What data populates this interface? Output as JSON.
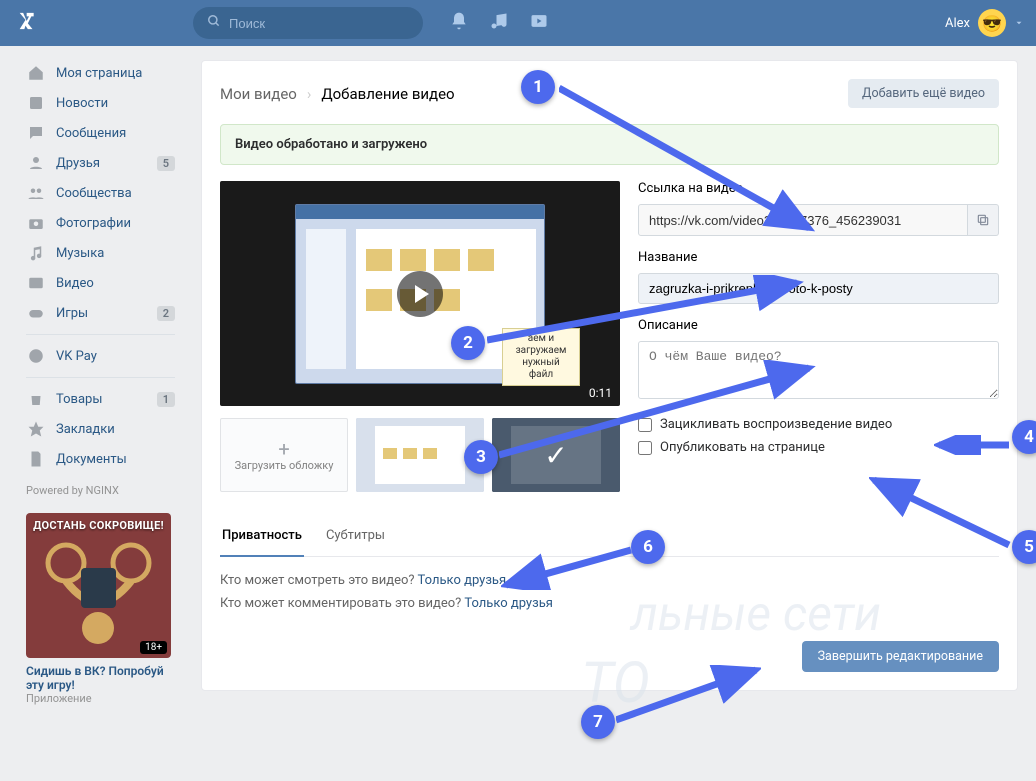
{
  "header": {
    "search_placeholder": "Поиск",
    "user_name": "Alex"
  },
  "sidebar": {
    "items": [
      {
        "label": "Моя страница"
      },
      {
        "label": "Новости"
      },
      {
        "label": "Сообщения"
      },
      {
        "label": "Друзья",
        "badge": "5"
      },
      {
        "label": "Сообщества"
      },
      {
        "label": "Фотографии"
      },
      {
        "label": "Музыка"
      },
      {
        "label": "Видео"
      },
      {
        "label": "Игры",
        "badge": "2"
      },
      {
        "label": "VK Pay"
      },
      {
        "label": "Товары",
        "badge": "1"
      },
      {
        "label": "Закладки"
      },
      {
        "label": "Документы"
      }
    ],
    "powered": "Powered by NGINX"
  },
  "promo": {
    "img_title": "ДОСТАНЬ СОКРОВИЩЕ!",
    "badge": "18+",
    "link": "Сидишь в ВК? Попробуй эту игру!",
    "sub": "Приложение"
  },
  "crumbs": {
    "root": "Мои видео",
    "current": "Добавление видео",
    "add_more": "Добавить ещё видео"
  },
  "status": "Видео обработано и загружено",
  "video": {
    "duration": "0:11",
    "tooltip": "аем и загружаем нужный файл"
  },
  "thumbs": {
    "upload_label": "Загрузить обложку"
  },
  "form": {
    "url_label": "Ссылка на видео",
    "url_value": "https://vk.com/video384697376_456239031",
    "title_label": "Название",
    "title_value": "zagruzka-i-prikreplenie-foto-k-posty",
    "desc_label": "Описание",
    "desc_placeholder": "О чём Ваше видео?",
    "loop_label": "Зацикливать воспроизведение видео",
    "publish_label": "Опубликовать на странице"
  },
  "tabs": {
    "privacy": "Приватность",
    "subtitles": "Субтитры"
  },
  "privacy": {
    "view_q": "Кто может смотреть это видео?",
    "view_a": "Только друзья",
    "comment_q": "Кто может комментировать это видео?",
    "comment_a": "Только друзья"
  },
  "finish_label": "Завершить редактирование",
  "watermark": {
    "l1": "льные сети",
    "l2": "TO"
  },
  "annotations": [
    "1",
    "2",
    "3",
    "4",
    "5",
    "6",
    "7"
  ]
}
